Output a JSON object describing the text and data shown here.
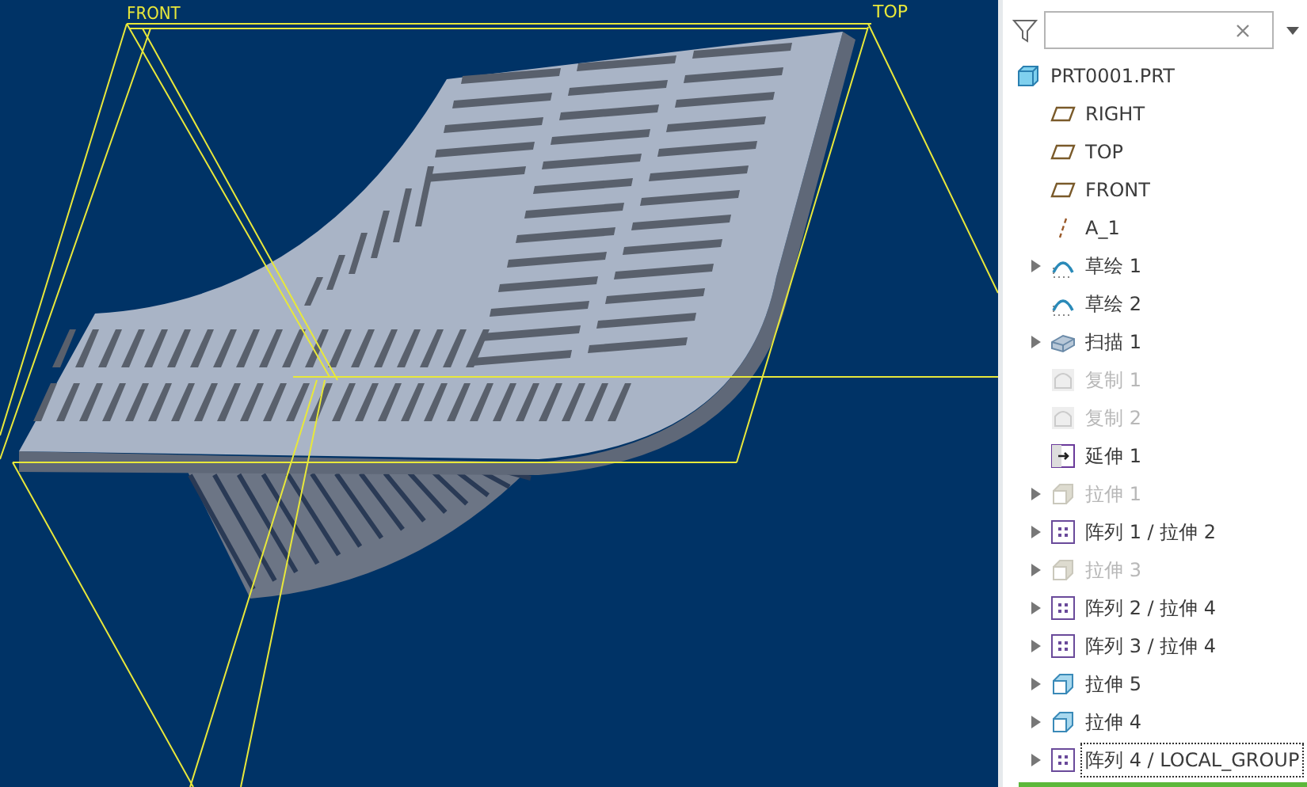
{
  "viewport": {
    "plane_labels": [
      "FRONT",
      "TOP"
    ]
  },
  "model_tree": {
    "items": [
      {
        "label": "PRT0001.PRT",
        "kind": "part",
        "expandable": false,
        "disabled": false,
        "selected": false
      },
      {
        "label": "RIGHT",
        "kind": "plane",
        "expandable": false,
        "disabled": false,
        "selected": false
      },
      {
        "label": "TOP",
        "kind": "plane",
        "expandable": false,
        "disabled": false,
        "selected": false
      },
      {
        "label": "FRONT",
        "kind": "plane",
        "expandable": false,
        "disabled": false,
        "selected": false
      },
      {
        "label": "A_1",
        "kind": "axis",
        "expandable": false,
        "disabled": false,
        "selected": false
      },
      {
        "label": "草绘 1",
        "kind": "sketch",
        "expandable": true,
        "disabled": false,
        "selected": false
      },
      {
        "label": "草绘 2",
        "kind": "sketch",
        "expandable": false,
        "disabled": false,
        "selected": false
      },
      {
        "label": "扫描 1",
        "kind": "sweep",
        "expandable": true,
        "disabled": false,
        "selected": false
      },
      {
        "label": "复制 1",
        "kind": "copy",
        "expandable": false,
        "disabled": true,
        "selected": false
      },
      {
        "label": "复制 2",
        "kind": "copy",
        "expandable": false,
        "disabled": true,
        "selected": false
      },
      {
        "label": "延伸 1",
        "kind": "extend",
        "expandable": false,
        "disabled": false,
        "selected": false
      },
      {
        "label": "拉伸 1",
        "kind": "extrude",
        "expandable": true,
        "disabled": true,
        "selected": false
      },
      {
        "label": "阵列 1 / 拉伸 2",
        "kind": "pattern",
        "expandable": true,
        "disabled": false,
        "selected": false
      },
      {
        "label": "拉伸 3",
        "kind": "extrude",
        "expandable": true,
        "disabled": true,
        "selected": false
      },
      {
        "label": "阵列 2 / 拉伸 4",
        "kind": "pattern",
        "expandable": true,
        "disabled": false,
        "selected": false
      },
      {
        "label": "阵列 3 / 拉伸 4",
        "kind": "pattern",
        "expandable": true,
        "disabled": false,
        "selected": false
      },
      {
        "label": "拉伸 5",
        "kind": "extrude",
        "expandable": true,
        "disabled": false,
        "selected": false
      },
      {
        "label": "拉伸 4",
        "kind": "extrude",
        "expandable": true,
        "disabled": false,
        "selected": false
      },
      {
        "label": "阵列 4 / LOCAL_GROUP",
        "kind": "pattern",
        "expandable": true,
        "disabled": false,
        "selected": true
      }
    ]
  }
}
